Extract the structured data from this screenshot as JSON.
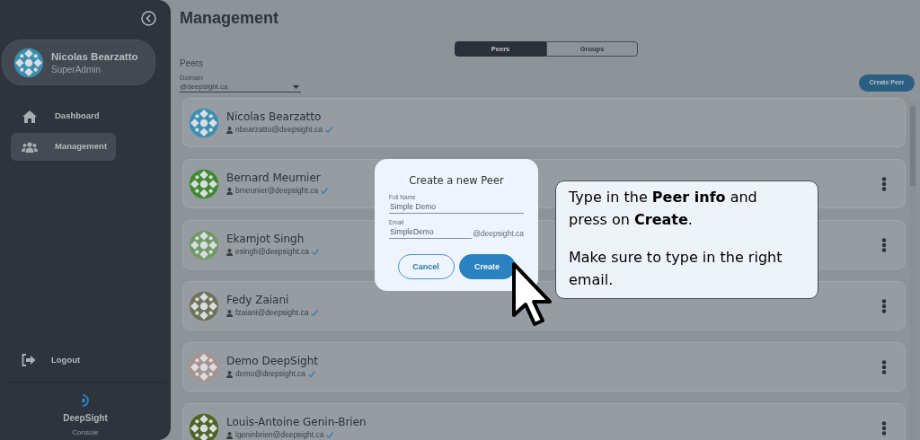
{
  "sidebar": {
    "profile": {
      "name": "Nicolas Bearzatto",
      "role": "SuperAdmin",
      "color": "#3a8fb0"
    },
    "items": [
      {
        "label": "Dashboard",
        "kind": "home",
        "selected": false
      },
      {
        "label": "Management",
        "kind": "users",
        "selected": true
      }
    ],
    "logout": "Logout",
    "brand": "DeepSight",
    "subtitle": "Console"
  },
  "page": {
    "title": "Management",
    "tabs": [
      {
        "label": "Peers",
        "selected": true
      },
      {
        "label": "Groups",
        "selected": false
      }
    ],
    "section": "Peers",
    "domain": {
      "label": "Domain",
      "value": "@deepsight.ca"
    },
    "create_button": "Create Peer"
  },
  "peers": [
    {
      "name": "Nicolas Bearzatto",
      "email": "nbearzatto@deepsight.ca",
      "color": "#3a8fb0",
      "menu": false
    },
    {
      "name": "Bernard Meurnier",
      "email": "bmeunier@deepsight.ca",
      "color": "#3f8a2e",
      "menu": true
    },
    {
      "name": "Ekamjot Singh",
      "email": "esingh@deepsight.ca",
      "color": "#6f9a66",
      "menu": true
    },
    {
      "name": "Fedy Zaiani",
      "email": "fzaiani@deepsight.ca",
      "color": "#6e7358",
      "menu": true
    },
    {
      "name": "Demo DeepSight",
      "email": "demo@deepsight.ca",
      "color": "#a8938c",
      "menu": true
    },
    {
      "name": "Louis-Antoine Genin-Brien",
      "email": "lgeninbrien@deepsight.ca",
      "color": "#4f6420",
      "menu": true
    }
  ],
  "dialog": {
    "title": "Create a new Peer",
    "fields": [
      {
        "label": "Full Name",
        "value": "Simple Demo"
      },
      {
        "label": "Email",
        "value": "SimpleDemo",
        "suffix": "@deepsight.ca"
      }
    ],
    "buttons": [
      {
        "label": "Cancel",
        "kind": "secondary"
      },
      {
        "label": "Create",
        "kind": "primary"
      }
    ]
  },
  "callout": {
    "paragraphs": [
      "Type in the **Peer info** and press on **Create**.",
      "Make sure to type in the right email."
    ]
  }
}
